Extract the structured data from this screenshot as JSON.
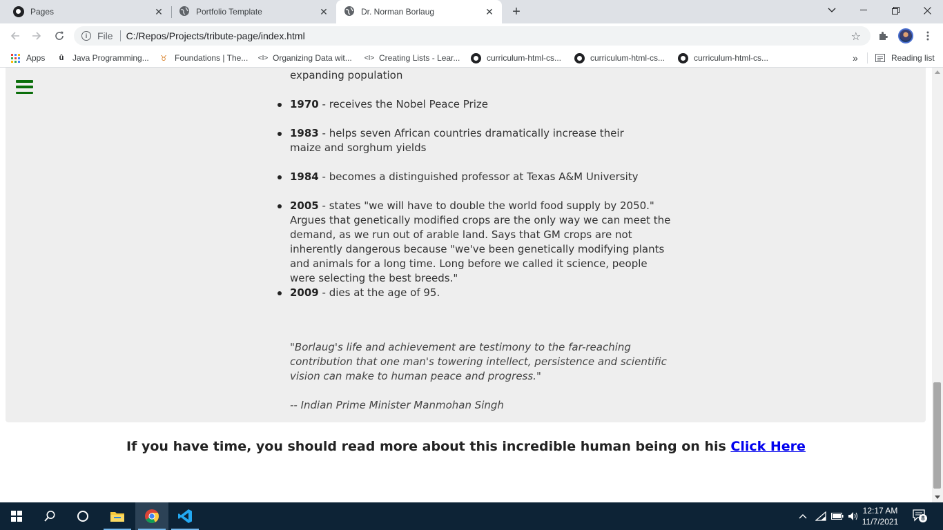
{
  "browser": {
    "tabs": [
      {
        "title": "Pages",
        "icon": "github-icon",
        "active": false
      },
      {
        "title": "Portfolio Template",
        "icon": "globe-icon",
        "active": false
      },
      {
        "title": "Dr. Norman Borlaug",
        "icon": "globe-icon",
        "active": true
      }
    ],
    "new_tab_symbol": "+",
    "address": {
      "scheme_label": "File",
      "url": "C:/Repos/Projects/tribute-page/index.html"
    },
    "bookmarks": [
      {
        "label": "Apps",
        "icon": "apps-grid-icon"
      },
      {
        "label": "Java Programming...",
        "icon": "udemy-icon"
      },
      {
        "label": "Foundations | The...",
        "icon": "odin-icon"
      },
      {
        "label": "Organizing Data wit...",
        "icon": "code-icon"
      },
      {
        "label": "Creating Lists - Lear...",
        "icon": "code-icon"
      },
      {
        "label": "curriculum-html-cs...",
        "icon": "github-icon"
      },
      {
        "label": "curriculum-html-cs...",
        "icon": "github-icon"
      },
      {
        "label": "curriculum-html-cs...",
        "icon": "github-icon"
      }
    ],
    "overflow_symbol": "»",
    "reading_list_label": "Reading list"
  },
  "page": {
    "partial_top_text": "expanding population",
    "timeline": [
      {
        "year": "1970",
        "text": " - receives the Nobel Peace Prize"
      },
      {
        "year": "1983",
        "text": " - helps seven African countries dramatically increase their maize and sorghum yields"
      },
      {
        "year": "1984",
        "text": " - becomes a distinguished professor at Texas A&M University"
      },
      {
        "year": "2005",
        "text": " - states \"we will have to double the world food supply by 2050.\" Argues that genetically modified crops are the only way we can meet the demand, as we run out of arable land. Says that GM crops are not inherently dangerous because \"we've been genetically modifying plants and animals for a long time. Long before we called it science, people were selecting the best breeds.\""
      },
      {
        "year": "2009",
        "text": " - dies at the age of 95."
      }
    ],
    "quote": "\"Borlaug's life and achievement are testimony to the far-reaching contribution that one man's towering intellect, persistence and scientific vision can make to human peace and progress.\"",
    "quote_author": "-- Indian Prime Minister Manmohan Singh",
    "read_more_text": "If you have time, you should read more about this incredible human being on his ",
    "read_more_link": "Click Here"
  },
  "taskbar": {
    "time": "12:17 AM",
    "date": "11/7/2021",
    "notification_count": "8"
  },
  "colors": {
    "hamburger": "#0b6e0b",
    "card_background": "#eeeeee",
    "link": "#0000ee",
    "taskbar": "#0d2336"
  }
}
